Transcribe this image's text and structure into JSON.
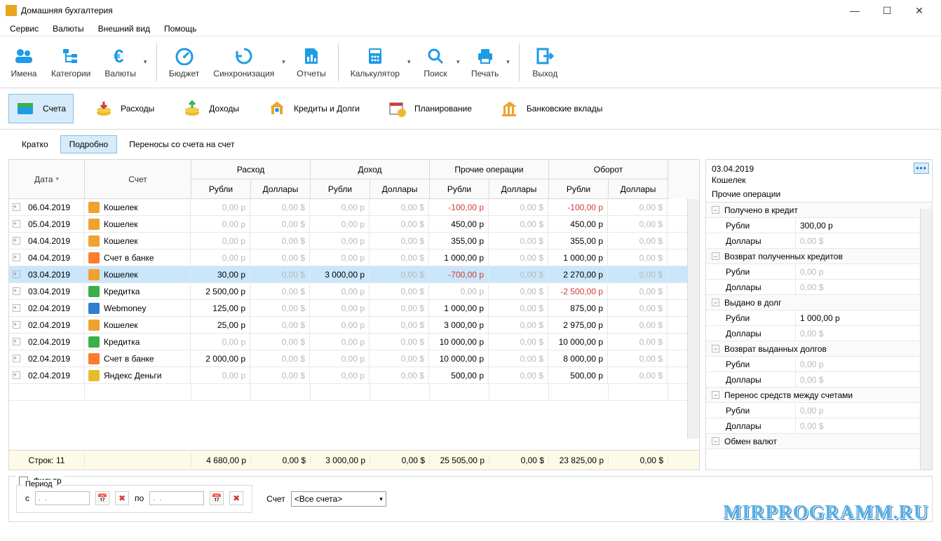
{
  "window": {
    "title": "Домашняя бухгалтерия"
  },
  "menu": {
    "items": [
      "Сервис",
      "Валюты",
      "Внешний вид",
      "Помощь"
    ]
  },
  "toolbar": {
    "names": [
      "Имена",
      "Категории",
      "Валюты",
      "Бюджет",
      "Синхронизация",
      "Отчеты",
      "Калькулятор",
      "Поиск",
      "Печать",
      "Выход"
    ]
  },
  "navtabs": {
    "items": [
      "Счета",
      "Расходы",
      "Доходы",
      "Кредиты и Долги",
      "Планирование",
      "Банковские вклады"
    ],
    "active": 0
  },
  "subtabs": {
    "items": [
      "Кратко",
      "Подробно",
      "Переносы со счета на счет"
    ],
    "active": 1
  },
  "grid": {
    "headers": {
      "date": "Дата",
      "account": "Счет",
      "groups": [
        "Расход",
        "Доход",
        "Прочие операции",
        "Оборот"
      ],
      "subRub": "Рубли",
      "subUsd": "Доллары"
    },
    "rows": [
      {
        "date": "06.04.2019",
        "acct": "Кошелек",
        "ic": "#efa22d",
        "vals": [
          "0,00 р",
          "0,00 $",
          "0,00 р",
          "0,00 $",
          "-100,00 р",
          "0,00 $",
          "-100,00 р",
          "0,00 $"
        ],
        "neg": [
          4,
          6
        ]
      },
      {
        "date": "05.04.2019",
        "acct": "Кошелек",
        "ic": "#efa22d",
        "vals": [
          "0,00 р",
          "0,00 $",
          "0,00 р",
          "0,00 $",
          "450,00 р",
          "0,00 $",
          "450,00 р",
          "0,00 $"
        ],
        "neg": []
      },
      {
        "date": "04.04.2019",
        "acct": "Кошелек",
        "ic": "#efa22d",
        "vals": [
          "0,00 р",
          "0,00 $",
          "0,00 р",
          "0,00 $",
          "355,00 р",
          "0,00 $",
          "355,00 р",
          "0,00 $"
        ],
        "neg": []
      },
      {
        "date": "04.04.2019",
        "acct": "Счет в банке",
        "ic": "#ff7b2e",
        "vals": [
          "0,00 р",
          "0,00 $",
          "0,00 р",
          "0,00 $",
          "1 000,00 р",
          "0,00 $",
          "1 000,00 р",
          "0,00 $"
        ],
        "neg": []
      },
      {
        "date": "03.04.2019",
        "acct": "Кошелек",
        "ic": "#efa22d",
        "vals": [
          "30,00 р",
          "0,00 $",
          "3 000,00 р",
          "0,00 $",
          "-700,00 р",
          "0,00 $",
          "2 270,00 р",
          "0,00 $"
        ],
        "neg": [
          4
        ],
        "sel": true
      },
      {
        "date": "03.04.2019",
        "acct": "Кредитка",
        "ic": "#3bb04a",
        "vals": [
          "2 500,00 р",
          "0,00 $",
          "0,00 р",
          "0,00 $",
          "0,00 р",
          "0,00 $",
          "-2 500,00 р",
          "0,00 $"
        ],
        "neg": [
          6
        ]
      },
      {
        "date": "02.04.2019",
        "acct": "Webmoney",
        "ic": "#2f7fd1",
        "vals": [
          "125,00 р",
          "0,00 $",
          "0,00 р",
          "0,00 $",
          "1 000,00 р",
          "0,00 $",
          "875,00 р",
          "0,00 $"
        ],
        "neg": []
      },
      {
        "date": "02.04.2019",
        "acct": "Кошелек",
        "ic": "#efa22d",
        "vals": [
          "25,00 р",
          "0,00 $",
          "0,00 р",
          "0,00 $",
          "3 000,00 р",
          "0,00 $",
          "2 975,00 р",
          "0,00 $"
        ],
        "neg": []
      },
      {
        "date": "02.04.2019",
        "acct": "Кредитка",
        "ic": "#3bb04a",
        "vals": [
          "0,00 р",
          "0,00 $",
          "0,00 р",
          "0,00 $",
          "10 000,00 р",
          "0,00 $",
          "10 000,00 р",
          "0,00 $"
        ],
        "neg": []
      },
      {
        "date": "02.04.2019",
        "acct": "Счет в банке",
        "ic": "#ff7b2e",
        "vals": [
          "2 000,00 р",
          "0,00 $",
          "0,00 р",
          "0,00 $",
          "10 000,00 р",
          "0,00 $",
          "8 000,00 р",
          "0,00 $"
        ],
        "neg": []
      },
      {
        "date": "02.04.2019",
        "acct": "Яндекс Деньги",
        "ic": "#e8bb2a",
        "vals": [
          "0,00 р",
          "0,00 $",
          "0,00 р",
          "0,00 $",
          "500,00 р",
          "0,00 $",
          "500,00 р",
          "0,00 $"
        ],
        "neg": []
      }
    ],
    "footer": {
      "label": "Строк: 11",
      "totals": [
        "4 680,00 р",
        "0,00 $",
        "3 000,00 р",
        "0,00 $",
        "25 505,00 р",
        "0,00 $",
        "23 825,00 р",
        "0,00 $"
      ]
    }
  },
  "side": {
    "date": "03.04.2019",
    "acct": "Кошелек",
    "section": "Прочие операции",
    "groups": [
      {
        "title": "Получено в кредит",
        "rows": [
          [
            "Рубли",
            "300,00 р"
          ],
          [
            "Доллары",
            "0,00 $"
          ]
        ]
      },
      {
        "title": "Возврат полученных кредитов",
        "rows": [
          [
            "Рубли",
            "0,00 р"
          ],
          [
            "Доллары",
            "0,00 $"
          ]
        ]
      },
      {
        "title": "Выдано в долг",
        "rows": [
          [
            "Рубли",
            "1 000,00 р"
          ],
          [
            "Доллары",
            "0,00 $"
          ]
        ]
      },
      {
        "title": "Возврат выданных долгов",
        "rows": [
          [
            "Рубли",
            "0,00 р"
          ],
          [
            "Доллары",
            "0,00 $"
          ]
        ]
      },
      {
        "title": "Перенос средств между счетами",
        "rows": [
          [
            "Рубли",
            "0,00 р"
          ],
          [
            "Доллары",
            "0,00 $"
          ]
        ]
      },
      {
        "title": "Обмен валют",
        "rows": []
      }
    ]
  },
  "filter": {
    "checkbox": "Фильтр",
    "periodLegend": "Период",
    "from": "с",
    "to": "по",
    "datePlaceholder": ".  .",
    "acctLabel": "Счет",
    "acctValue": "<Все счета>"
  },
  "watermark": "MIRPROGRAMM.RU"
}
